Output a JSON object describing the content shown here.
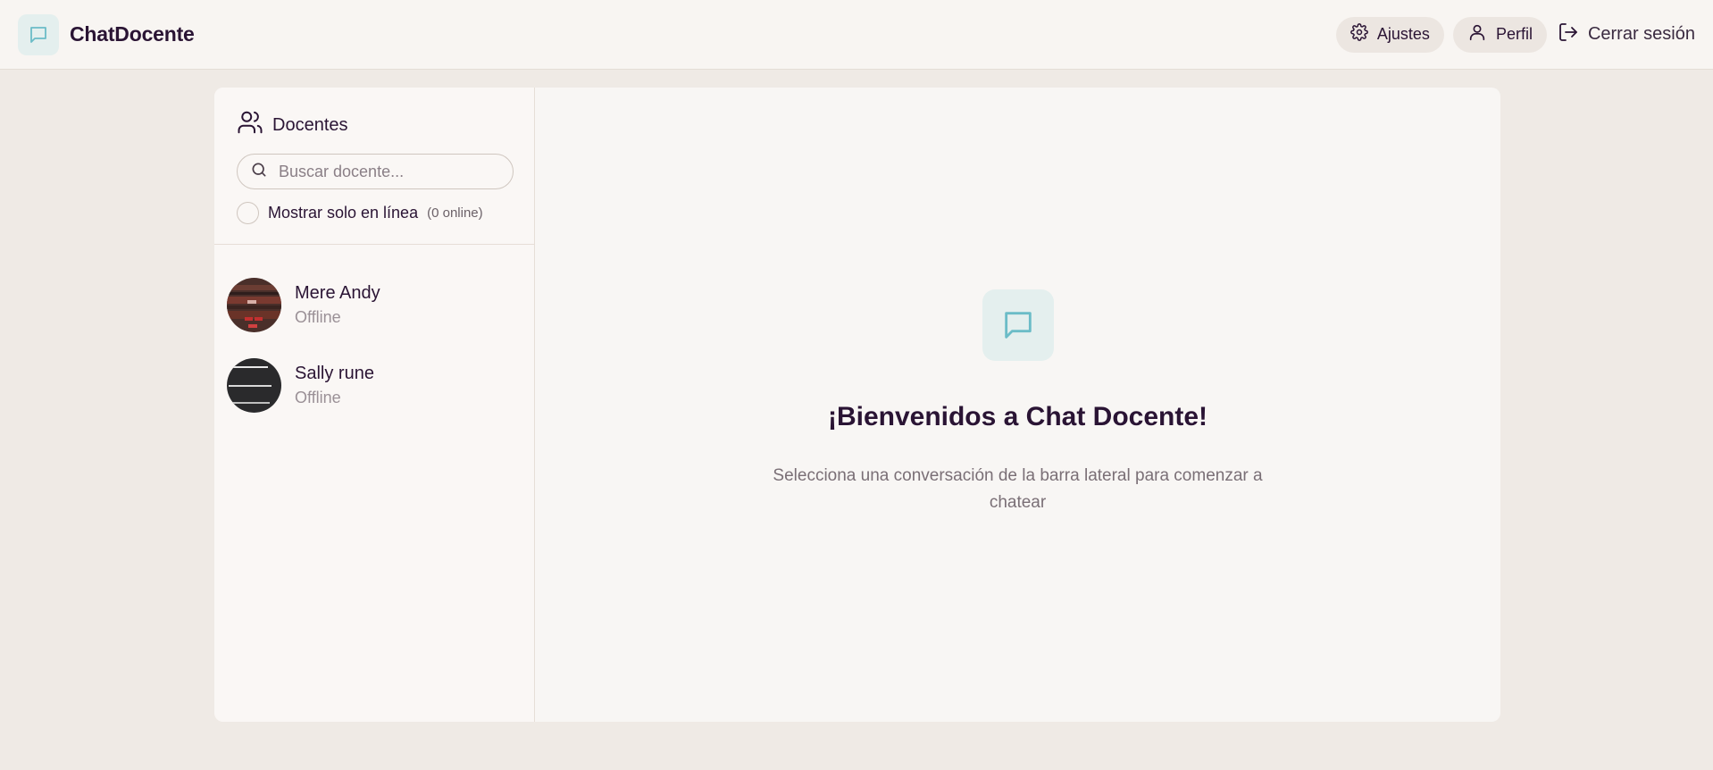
{
  "header": {
    "brand": "ChatDocente",
    "settings_label": "Ajustes",
    "profile_label": "Perfil",
    "logout_label": "Cerrar sesión"
  },
  "sidebar": {
    "title": "Docentes",
    "search_placeholder": "Buscar docente...",
    "online_filter_label": "Mostrar solo en línea",
    "online_count": "(0 online)",
    "contacts": [
      {
        "name": "Mere Andy",
        "status": "Offline"
      },
      {
        "name": "Sally rune",
        "status": "Offline"
      }
    ]
  },
  "welcome": {
    "title": "¡Bienvenidos a Chat Docente!",
    "subtitle": "Selecciona una conversación de la barra lateral para comenzar a chatear"
  },
  "colors": {
    "accent_teal": "#6bbcc7",
    "icon_bg": "#e4efee",
    "page_bg": "#efeae5",
    "text_dark": "#2a1434"
  }
}
